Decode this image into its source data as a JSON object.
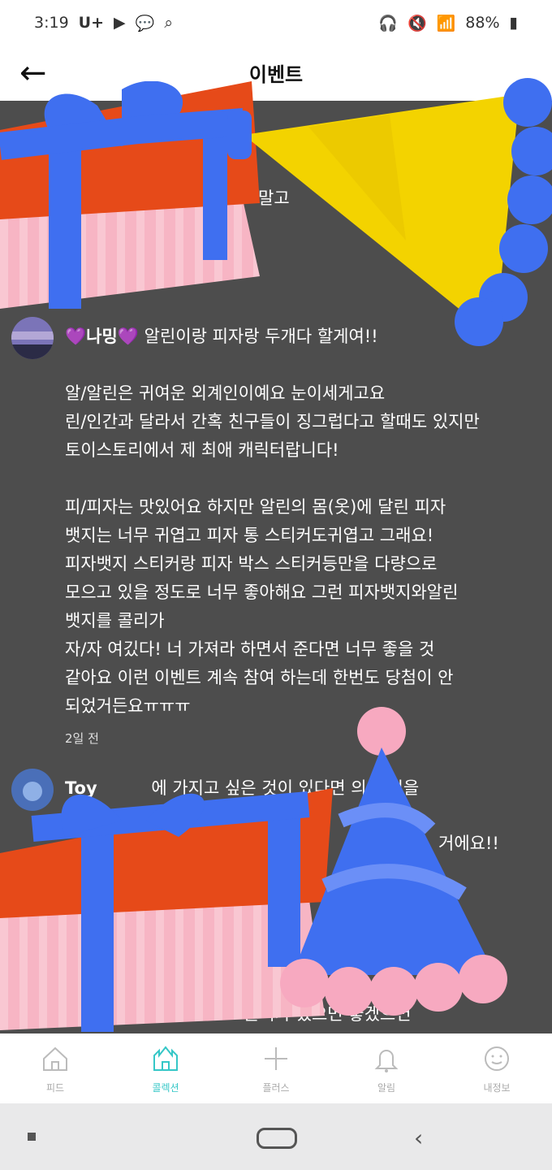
{
  "status": {
    "time": "3:19",
    "carrier": "U+",
    "battery": "88%"
  },
  "header": {
    "title": "이벤트",
    "back_glyph": "←"
  },
  "comments": [
    {
      "partial_lines": [
        "말고",
        ")"
      ]
    },
    {
      "username": "💜나밍💜",
      "first_line": "알린이랑 피자랑 두개다 할게여!!",
      "lines": [
        "알/알린은 귀여운 외계인이예요 눈이세게고요",
        "린/인간과 달라서 간혹 친구들이 징그럽다고 할때도 있지만",
        "토이스토리에서 제 최애 캐릭터랍니다!",
        "",
        "피/피자는 맛있어요 하지만 알린의 몸(옷)에 달린 피자",
        "뱃지는 너무 귀엽고 피자 통 스티커도귀엽고 그래요!",
        "피자뱃지 스티커랑 피자 박스 스티커등만을 다량으로",
        "모으고 있을 정도로 너무 좋아해요 그런 피자뱃지와알린",
        "뱃지를 콜리가",
        "자/자 여깄다! 너 가져라 하면서 준다면 너무 좋을 것",
        "같아요 이런 이벤트 계속 참여 하는데 한번도 당첨이 안",
        "되었거든요ㅠㅠㅠ"
      ],
      "time": "2일 전"
    },
    {
      "username": "Toy",
      "partial_lines": [
        "에 가지고 싶은 것이 있다면 의 물건을",
        "거에요!!",
        "콜리가 했으면 좋겠으면"
      ]
    }
  ],
  "nav": [
    {
      "label": "피드",
      "icon": "home-icon"
    },
    {
      "label": "콜렉션",
      "icon": "castle-icon"
    },
    {
      "label": "플러스",
      "icon": "plus-icon"
    },
    {
      "label": "알림",
      "icon": "bell-icon"
    },
    {
      "label": "내정보",
      "icon": "profile-icon"
    }
  ],
  "colors": {
    "accent": "#35c7c7",
    "feed_bg": "#4d4d4d",
    "gift_box": "#e64a19",
    "ribbon": "#3f6ff0",
    "cone": "#f3d300"
  }
}
